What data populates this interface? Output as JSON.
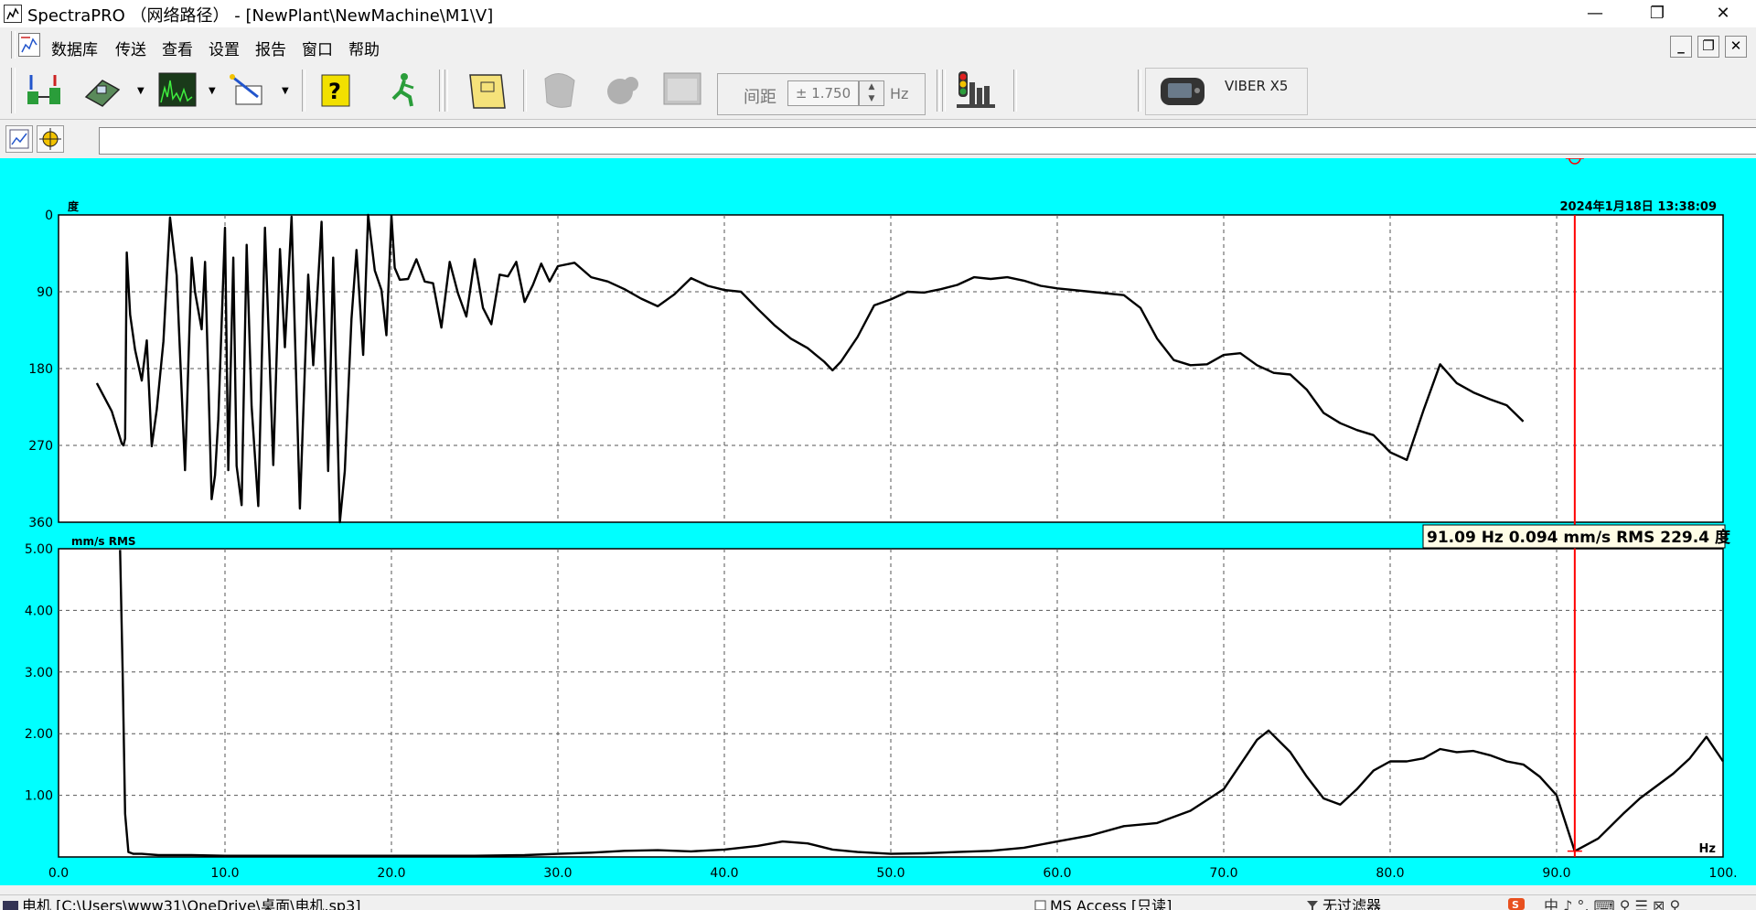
{
  "window": {
    "title": "SpectraPRO （网络路径） - [NewPlant\\NewMachine\\M1\\V]",
    "minimize": "—",
    "maximize": "❐",
    "close": "✕"
  },
  "menu": {
    "items": [
      "数据库",
      "传送",
      "查看",
      "设置",
      "报告",
      "窗口",
      "帮助"
    ],
    "mdi_minimize": "_",
    "mdi_restore": "❐",
    "mdi_close": "✕"
  },
  "toolbar": {
    "range_label": "间距",
    "range_value": "± 1.750",
    "range_unit": "Hz",
    "device_name": "VIBER X5",
    "icons": [
      "database-transfer-icon",
      "instrument-icon",
      "spectrum-icon",
      "setup-wand-icon",
      "help-icon",
      "exit-run-icon",
      "report-notebook-icon",
      "disabled-spin-icon",
      "disabled-gear-icon",
      "disabled-window-icon",
      "traffic-light-alarm-icon",
      "viber-device-icon"
    ]
  },
  "cmdbar": {
    "icons": [
      "graph-mode-icon",
      "cursor-target-icon"
    ],
    "input_value": ""
  },
  "colors": {
    "plot_background": "#00ffff",
    "trace": "#000000",
    "cursor": "#ff0000"
  },
  "statusbar": {
    "file_path": "电机 [C:\\Users\\www31\\OneDrive\\桌面\\电机.sp3]",
    "db_mode": "MS Access [只读]",
    "filter": "无过滤器",
    "ime_chars": "中 ♪ °, ⌨ ♀ ☰ ⊠ ♀"
  },
  "chart_data": [
    {
      "type": "line",
      "name": "phase",
      "ylabel": "度",
      "timestamp": "2024年1月18日 13:38:09",
      "ylim": [
        0,
        360
      ],
      "y_inverted": true,
      "yticks": [
        "0",
        "90",
        "180",
        "270",
        "360"
      ],
      "xlim": [
        0,
        100
      ],
      "grid": true,
      "x": [
        2.3,
        3.2,
        3.8,
        3.9,
        4.0,
        4.1,
        4.3,
        4.6,
        5.0,
        5.3,
        5.6,
        5.9,
        6.3,
        6.7,
        7.1,
        7.6,
        8.0,
        8.2,
        8.6,
        8.8,
        9.2,
        9.4,
        9.6,
        10.0,
        10.2,
        10.5,
        10.7,
        11.0,
        11.3,
        11.6,
        12.0,
        12.4,
        12.9,
        13.3,
        13.6,
        14.0,
        14.5,
        15.0,
        15.3,
        15.8,
        16.2,
        16.5,
        16.9,
        17.2,
        17.6,
        17.9,
        18.3,
        18.6,
        19.0,
        19.4,
        19.7,
        20.0,
        20.2,
        20.5,
        21.0,
        21.5,
        22.0,
        22.5,
        23.0,
        23.5,
        24.0,
        24.5,
        25.0,
        25.5,
        26.0,
        26.5,
        27.0,
        27.5,
        28.0,
        28.5,
        29.0,
        29.5,
        30.0,
        31.0,
        32.0,
        33.0,
        34.0,
        35.0,
        36.0,
        37.0,
        38.0,
        39.0,
        40.0,
        41.0,
        42.0,
        43.0,
        44.0,
        45.0,
        46.0,
        46.5,
        47.0,
        48.0,
        49.0,
        50.0,
        51.0,
        52.0,
        53.0,
        54.0,
        55.0,
        56.0,
        57.0,
        58.0,
        59.0,
        60.0,
        62.0,
        64.0,
        65.0,
        66.0,
        67.0,
        68.0,
        69.0,
        70.0,
        71.0,
        72.0,
        73.0,
        74.0,
        75.0,
        76.0,
        77.0,
        78.0,
        79.0,
        80.0,
        81.0,
        82.0,
        83.0,
        84.0,
        85.0,
        86.0,
        87.0,
        88.0,
        89.0,
        90.0,
        91.09,
        92.2,
        93.0,
        94.0,
        95.0,
        96.0,
        97.0,
        98.0,
        99.0,
        100.0
      ],
      "y": [
        197,
        230,
        268,
        270,
        262,
        44,
        117,
        158,
        194,
        147,
        271,
        228,
        148,
        3,
        71,
        299,
        50,
        90,
        134,
        55,
        333,
        305,
        239,
        15,
        299,
        50,
        294,
        340,
        35,
        224,
        341,
        15,
        293,
        40,
        155,
        2,
        344,
        70,
        176,
        8,
        300,
        50,
        360,
        300,
        122,
        41,
        164,
        0,
        65,
        88,
        141,
        1,
        62,
        76,
        75,
        52,
        78,
        80,
        132,
        55,
        92,
        119,
        52,
        109,
        128,
        70,
        72,
        55,
        102,
        82,
        57,
        78,
        60,
        56,
        73,
        78,
        87,
        98,
        107,
        93,
        74,
        83,
        88,
        90,
        110,
        129,
        145,
        156,
        172,
        182,
        172,
        143,
        106,
        99,
        90,
        91,
        87,
        82,
        73,
        75,
        73,
        77,
        83,
        86,
        90,
        94,
        109,
        145,
        170,
        176,
        175,
        164,
        162,
        176,
        185,
        187,
        205,
        232,
        244,
        252,
        258,
        278,
        287,
        229,
        175,
        197,
        208,
        216,
        223,
        242
      ]
    },
    {
      "type": "line",
      "name": "amplitude",
      "ylabel": "mm/s  RMS",
      "xlabel": "Hz",
      "ylim": [
        0,
        5
      ],
      "yticks": [
        "5.00",
        "4.00",
        "3.00",
        "2.00",
        "1.00"
      ],
      "xlim": [
        0,
        100
      ],
      "xticks": [
        "0.0",
        "10.0",
        "20.0",
        "30.0",
        "40.0",
        "50.0",
        "60.0",
        "70.0",
        "80.0",
        "90.0",
        "100."
      ],
      "grid": true,
      "x": [
        3.7,
        3.85,
        4.0,
        4.2,
        4.5,
        5.0,
        6.0,
        8.0,
        10.0,
        15.0,
        20.0,
        25.0,
        28.0,
        30.0,
        32.0,
        34.0,
        36.0,
        38.0,
        40.0,
        42.0,
        43.5,
        45.0,
        46.5,
        48.0,
        50.0,
        52.0,
        54.0,
        56.0,
        58.0,
        60.0,
        62.0,
        64.0,
        66.0,
        68.0,
        70.0,
        71.0,
        72.0,
        72.7,
        74.0,
        75.0,
        76.0,
        77.0,
        78.0,
        79.0,
        80.0,
        81.0,
        82.0,
        83.0,
        84.0,
        85.0,
        86.0,
        87.0,
        88.0,
        89.0,
        90.0,
        91.09,
        92.5,
        94.0,
        95.0,
        96.0,
        97.0,
        98.0,
        99.0,
        100.0
      ],
      "y": [
        4.98,
        3.0,
        0.7,
        0.08,
        0.05,
        0.05,
        0.03,
        0.03,
        0.02,
        0.02,
        0.02,
        0.02,
        0.03,
        0.05,
        0.07,
        0.1,
        0.11,
        0.09,
        0.12,
        0.18,
        0.25,
        0.22,
        0.12,
        0.08,
        0.05,
        0.06,
        0.08,
        0.1,
        0.15,
        0.25,
        0.35,
        0.5,
        0.55,
        0.75,
        1.1,
        1.5,
        1.9,
        2.05,
        1.7,
        1.3,
        0.95,
        0.85,
        1.1,
        1.4,
        1.55,
        1.55,
        1.6,
        1.75,
        1.7,
        1.72,
        1.65,
        1.55,
        1.5,
        1.3,
        1.0,
        0.094,
        0.3,
        0.7,
        0.95,
        1.15,
        1.35,
        1.6,
        1.95,
        1.55
      ]
    }
  ],
  "cursor": {
    "x": 91.09,
    "readout": "91.09 Hz 0.094 mm/s RMS 229.4 度"
  }
}
